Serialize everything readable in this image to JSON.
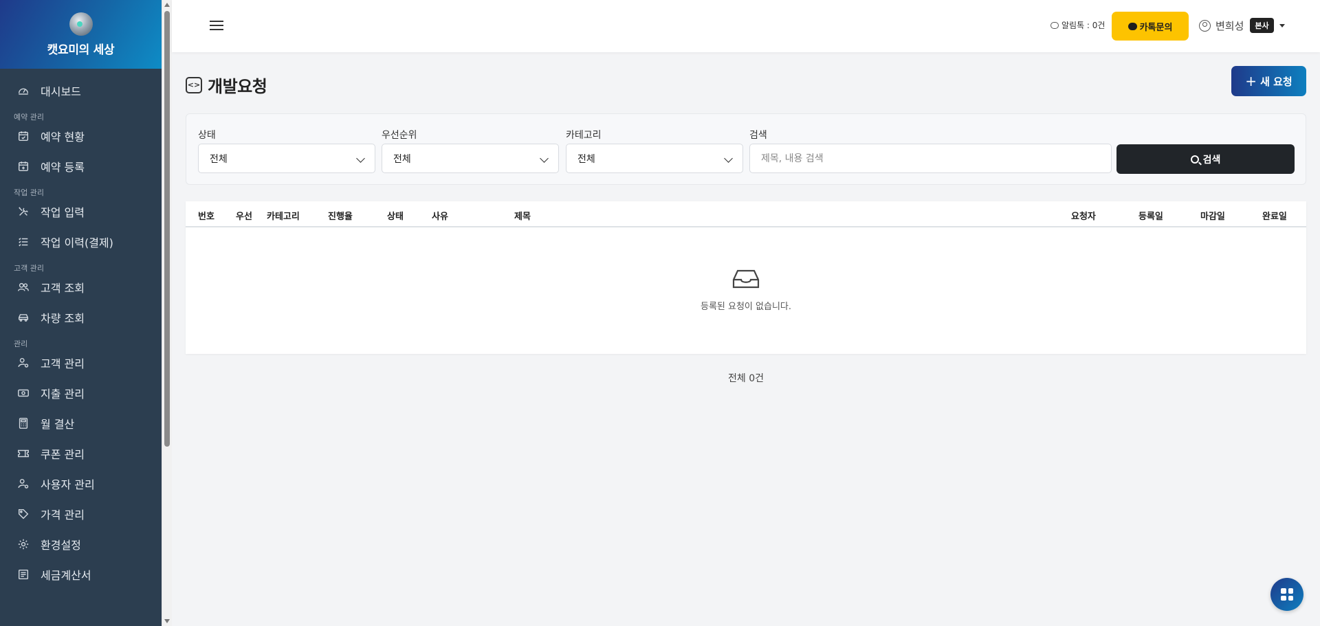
{
  "brand": {
    "title": "캣요미의 세상"
  },
  "sidebar": {
    "items": [
      {
        "type": "item",
        "label": "대시보드",
        "icon": "speedometer-icon"
      },
      {
        "type": "section",
        "label": "예약 관리"
      },
      {
        "type": "item",
        "label": "예약 현황",
        "icon": "calendar-check-icon"
      },
      {
        "type": "item",
        "label": "예약 등록",
        "icon": "calendar-plus-icon"
      },
      {
        "type": "section",
        "label": "작업 관리"
      },
      {
        "type": "item",
        "label": "작업 입력",
        "icon": "tools-icon"
      },
      {
        "type": "item",
        "label": "작업 이력(결제)",
        "icon": "list-check-icon"
      },
      {
        "type": "section",
        "label": "고객 관리"
      },
      {
        "type": "item",
        "label": "고객 조회",
        "icon": "people-icon"
      },
      {
        "type": "item",
        "label": "차량 조회",
        "icon": "car-icon"
      },
      {
        "type": "section",
        "label": "관리"
      },
      {
        "type": "item",
        "label": "고객 관리",
        "icon": "person-gear-icon"
      },
      {
        "type": "item",
        "label": "지출 관리",
        "icon": "cash-icon"
      },
      {
        "type": "item",
        "label": "월 결산",
        "icon": "calculator-icon"
      },
      {
        "type": "item",
        "label": "쿠폰 관리",
        "icon": "ticket-icon"
      },
      {
        "type": "item",
        "label": "사용자 관리",
        "icon": "person-gear-icon"
      },
      {
        "type": "item",
        "label": "가격 관리",
        "icon": "tag-icon"
      },
      {
        "type": "item",
        "label": "환경설정",
        "icon": "gear-icon"
      },
      {
        "type": "item",
        "label": "세금계산서",
        "icon": "receipt-icon"
      }
    ]
  },
  "header": {
    "alimtalk": "알림톡 : 0건",
    "kakao_button": "카톡문의",
    "user_name": "변희성",
    "user_badge": "본사"
  },
  "page": {
    "title": "개발요청",
    "new_button": "새 요청"
  },
  "filters": {
    "status": {
      "label": "상태",
      "value": "전체"
    },
    "priority": {
      "label": "우선순위",
      "value": "전체"
    },
    "category": {
      "label": "카테고리",
      "value": "전체"
    },
    "search": {
      "label": "검색",
      "placeholder": "제목, 내용 검색",
      "value": ""
    },
    "search_button": "검색"
  },
  "table": {
    "columns": [
      "번호",
      "우선",
      "카테고리",
      "진행율",
      "상태",
      "사유",
      "제목",
      "요청자",
      "등록일",
      "마감일",
      "완료일"
    ],
    "rows": [],
    "empty_message": "등록된 요청이 없습니다."
  },
  "footer": {
    "total": "전체 0건"
  },
  "colors": {
    "sidebar_bg": "#2c3e50",
    "brand_gradient_start": "#1f3a8a",
    "brand_gradient_end": "#0e8cc6",
    "kakao_yellow": "#fdc300",
    "dark_button": "#212529"
  }
}
